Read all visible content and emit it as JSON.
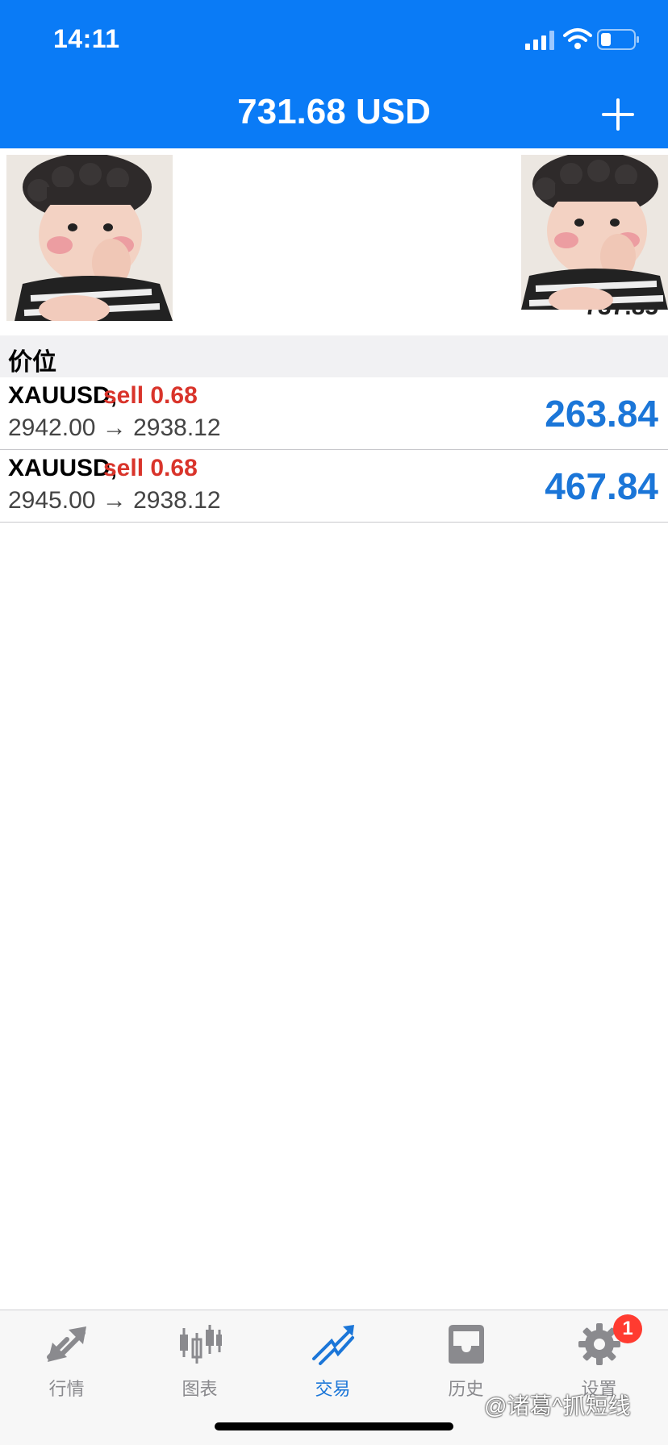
{
  "status": {
    "time": "14:11"
  },
  "nav": {
    "title": "731.68 USD"
  },
  "summary": {
    "label": "",
    "value": "737.85"
  },
  "section": {
    "title": "价位"
  },
  "trades": [
    {
      "symbol": "XAUUSD,",
      "side": "sell 0.68",
      "prices": "2942.00 → 2938.12",
      "profit": "263.84"
    },
    {
      "symbol": "XAUUSD,",
      "side": "sell 0.68",
      "prices": "2945.00 → 2938.12",
      "profit": "467.84"
    }
  ],
  "tabs": [
    {
      "label": "行情",
      "icon": "quotes-icon",
      "active": false
    },
    {
      "label": "图表",
      "icon": "chart-candles-icon",
      "active": false
    },
    {
      "label": "交易",
      "icon": "trade-icon",
      "active": true
    },
    {
      "label": "历史",
      "icon": "history-inbox-icon",
      "active": false
    },
    {
      "label": "设置",
      "icon": "gear-icon",
      "active": false
    }
  ],
  "badge": {
    "count": "1"
  },
  "watermark": "@诸葛^抓短线",
  "colors": {
    "brand": "#0a7bf6",
    "profit": "#1b76d8",
    "sell": "#d9342b"
  }
}
